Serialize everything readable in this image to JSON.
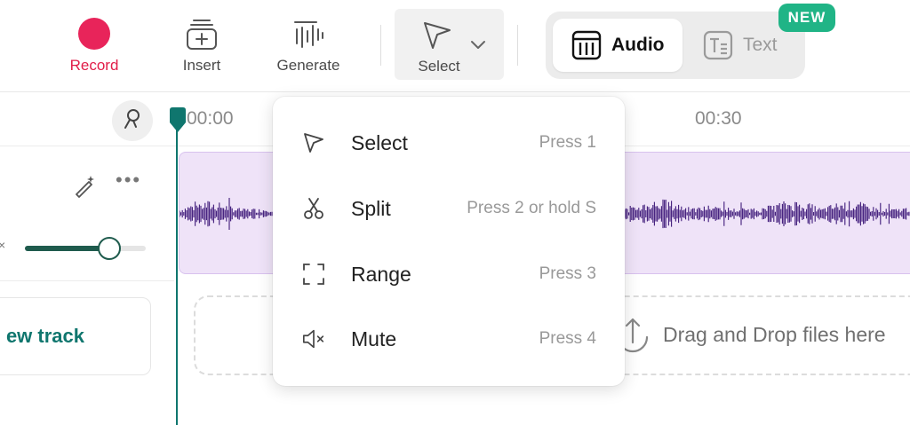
{
  "toolbar": {
    "record_label": "Record",
    "insert_label": "Insert",
    "generate_label": "Generate",
    "select_label": "Select",
    "audio_label": "Audio",
    "text_label": "Text",
    "new_badge": "NEW"
  },
  "timeline": {
    "ticks": [
      "00:00",
      "00:30"
    ]
  },
  "tracks": {
    "add_track_label": "ew track",
    "volume_level": 0.7
  },
  "dropzone": {
    "text": "Drag and Drop files here"
  },
  "select_menu": {
    "items": [
      {
        "label": "Select",
        "hint": "Press 1",
        "icon": "cursor-icon"
      },
      {
        "label": "Split",
        "hint": "Press 2 or hold S",
        "icon": "scissors-icon"
      },
      {
        "label": "Range",
        "hint": "Press 3",
        "icon": "range-icon"
      },
      {
        "label": "Mute",
        "hint": "Press 4",
        "icon": "mute-icon"
      }
    ]
  },
  "colors": {
    "record": "#e8245a",
    "accent": "#0f766e",
    "badge": "#20b486",
    "clip_bg": "#efe3f8",
    "waveform": "#3f1a7a"
  }
}
